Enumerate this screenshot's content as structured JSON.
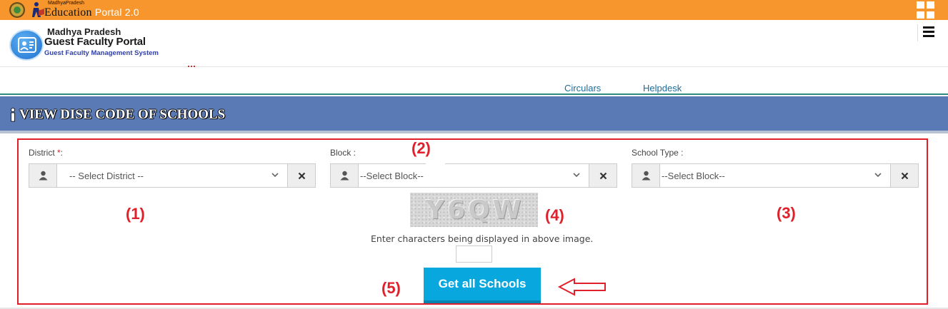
{
  "topbar": {
    "brand_small": "MadhyaPradesh",
    "brand_main": "Education",
    "brand_version": "Portal 2.0"
  },
  "header": {
    "line1": "Madhya Pradesh",
    "line2": "Guest Faculty Portal",
    "line3": "Guest Faculty Management System"
  },
  "nav": {
    "circulars": "Circulars",
    "helpdesk": "Helpdesk"
  },
  "section": {
    "title": "VIEW DISE CODE OF SCHOOLS"
  },
  "form": {
    "district": {
      "label": "District ",
      "required_mark": "*",
      "label_suffix": ":",
      "selected": "-- Select District --"
    },
    "block": {
      "label": "Block :",
      "selected": "--Select Block--"
    },
    "school_type": {
      "label": "School Type :",
      "selected": "--Select Block--"
    },
    "captcha_text": "Y6QW",
    "captcha_hint": "Enter characters being displayed in above image.",
    "captcha_value": "",
    "submit_label": "Get all Schools"
  },
  "annotations": {
    "a1": "(1)",
    "a2": "(2)",
    "a3": "(3)",
    "a4": "(4)",
    "a5": "(5)"
  },
  "colors": {
    "topbar": "#f7962c",
    "band": "#5a7ab5",
    "button": "#08a8df",
    "annotation": "#e0202a"
  },
  "icons": {
    "topbar_left": "state-seal-icon",
    "topbar_brand": "education-reader-icon",
    "topbar_right": "apps-grid-icon",
    "header_logo": "faculty-portal-logo-icon",
    "header_menu": "hamburger-menu-icon",
    "section": "info-icon",
    "field_left": "user-icon",
    "field_right": "clear-x-icon",
    "select_caret": "chevron-down-icon",
    "annotation_arrow": "arrow-left-icon"
  }
}
